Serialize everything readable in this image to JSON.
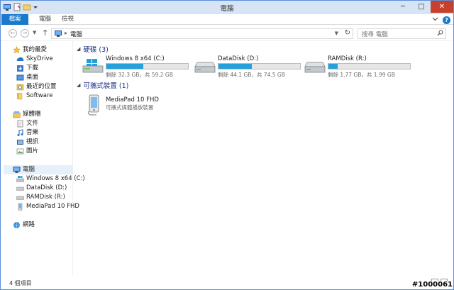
{
  "window": {
    "title": "電腦"
  },
  "quick_access": {
    "icons": [
      "computer-icon",
      "properties-icon",
      "new-folder-icon",
      "customize-dropdown-icon"
    ]
  },
  "window_controls": {
    "minimize": "─",
    "maximize": "□",
    "close": "✕"
  },
  "ribbon": {
    "file_tab": "檔案",
    "tabs": [
      "電腦",
      "檢視"
    ],
    "expand_icon": "chevron-down-icon",
    "help_icon": "help-icon",
    "help_glyph": "?"
  },
  "address": {
    "back": "←",
    "forward": "→",
    "up": "↑",
    "path": "電腦",
    "search_placeholder": "搜尋 電腦"
  },
  "nav": {
    "favorites": {
      "label": "我的最愛",
      "items": [
        "SkyDrive",
        "下載",
        "桌面",
        "最近的位置",
        "Software"
      ]
    },
    "libraries": {
      "label": "媒體櫃",
      "items": [
        "文件",
        "音樂",
        "視訊",
        "圖片"
      ]
    },
    "computer": {
      "label": "電腦",
      "items": [
        "Windows 8 x64 (C:)",
        "DataDisk (D:)",
        "RAMDisk (R:)",
        "MediaPad 10 FHD"
      ]
    },
    "network": {
      "label": "網路"
    }
  },
  "content": {
    "hard_drives": {
      "heading": "硬碟 (3)",
      "drives": [
        {
          "name": "Windows 8 x64 (C:)",
          "free": "剩餘 32.3 GB，共 59.2 GB",
          "used_fraction": 0.45
        },
        {
          "name": "DataDisk (D:)",
          "free": "剩餘 44.1 GB，共 74.5 GB",
          "used_fraction": 0.41
        },
        {
          "name": "RAMDisk (R:)",
          "free": "剩餘 1.77 GB，共 1.99 GB",
          "used_fraction": 0.11
        }
      ]
    },
    "portable": {
      "heading": "可攜式裝置 (1)",
      "device": {
        "name": "MediaPad 10 FHD",
        "description": "可攜式媒體播放裝置"
      }
    }
  },
  "status": {
    "count": "4 個項目"
  },
  "watermark": "#1000061",
  "colors": {
    "accent": "#1979ca",
    "progress": "#26a0da",
    "close": "#c7402d",
    "heading": "#1e3287"
  }
}
